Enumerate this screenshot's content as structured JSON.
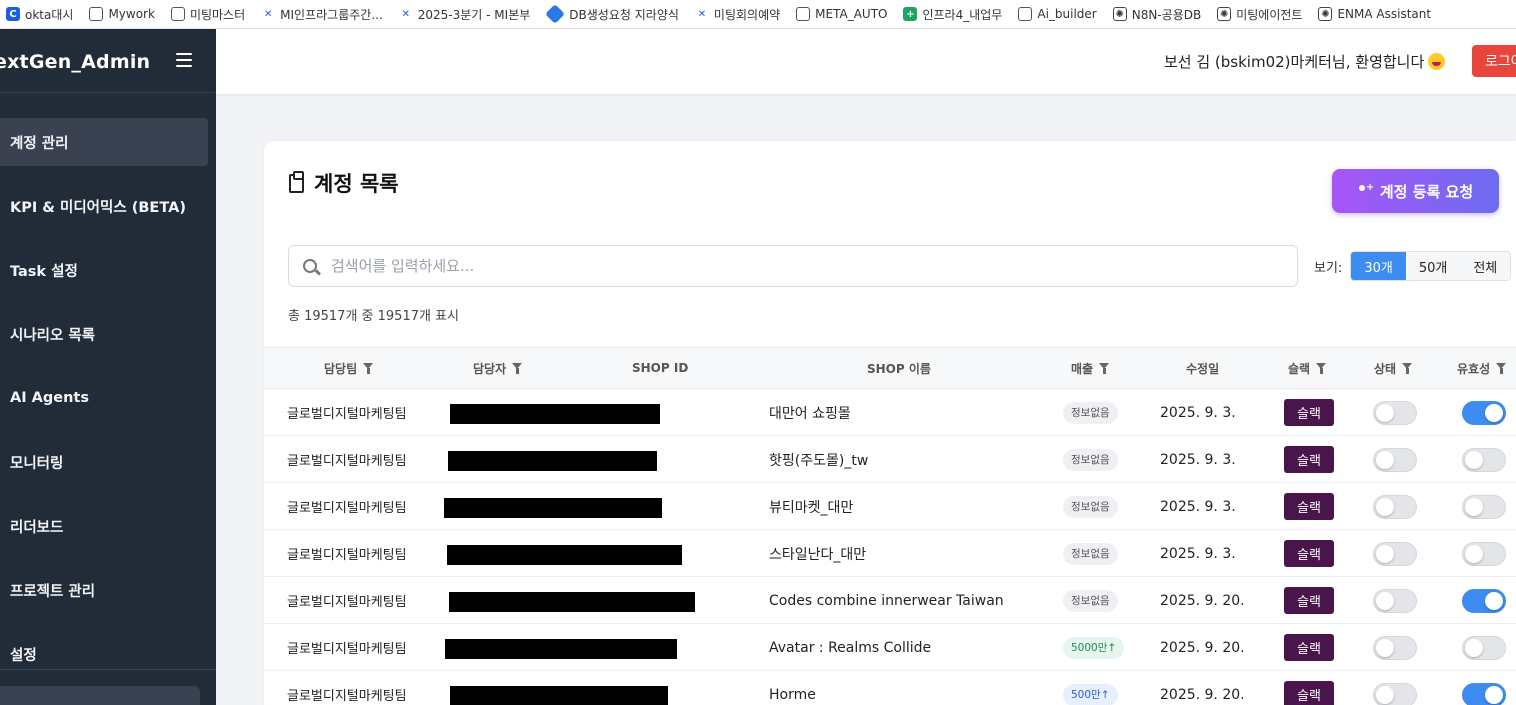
{
  "bookmarks": [
    {
      "label": "okta대시",
      "icon": "okta-icon"
    },
    {
      "label": "Mywork",
      "icon": "globe-icon"
    },
    {
      "label": "미팅마스터",
      "icon": "globe-icon"
    },
    {
      "label": "MI인프라그룹주간...",
      "icon": "confluence-icon"
    },
    {
      "label": "2025-3분기 - MI본부",
      "icon": "confluence-icon"
    },
    {
      "label": "DB생성요청 지라양식",
      "icon": "jira-icon"
    },
    {
      "label": "미팅회의예약",
      "icon": "confluence-icon"
    },
    {
      "label": "META_AUTO",
      "icon": "folder-icon"
    },
    {
      "label": "인프라4_내업무",
      "icon": "sheets-icon"
    },
    {
      "label": "Ai_builder",
      "icon": "folder-icon"
    },
    {
      "label": "N8N-공용DB",
      "icon": "openai-icon"
    },
    {
      "label": "미팅에이전트",
      "icon": "openai-icon"
    },
    {
      "label": "ENMA Assistant",
      "icon": "openai-icon"
    }
  ],
  "sidebar": {
    "brand": "extGen_Admin",
    "items": [
      {
        "label": "계정 관리",
        "active": true
      },
      {
        "label": "KPI & 미디어믹스 (BETA)",
        "active": false
      },
      {
        "label": "Task 설정",
        "active": false
      },
      {
        "label": "시나리오 목록",
        "active": false
      },
      {
        "label": "AI Agents",
        "active": false
      },
      {
        "label": "모니터링",
        "active": false
      },
      {
        "label": "리더보드",
        "active": false
      },
      {
        "label": "프로젝트 관리",
        "active": false
      },
      {
        "label": "설정",
        "active": false
      }
    ]
  },
  "header": {
    "welcome": "보선 김 (bskim02)마케터님, 환영합니다",
    "logout_label": "로그아웃"
  },
  "main": {
    "title": "계정 목록",
    "request_button": "계정 등록 요청",
    "search_placeholder": "검색어를 입력하세요...",
    "view_label": "보기:",
    "view_options": [
      {
        "label": "30개",
        "active": true
      },
      {
        "label": "50개",
        "active": false
      },
      {
        "label": "전체",
        "active": false
      }
    ],
    "count_text": "총 19517개 중 19517개 표시"
  },
  "table": {
    "columns": [
      "담당팀",
      "담당자",
      "SHOP ID",
      "SHOP 이름",
      "매출",
      "수정일",
      "슬랙",
      "상태",
      "유효성"
    ],
    "slack_label": "슬랙",
    "rows": [
      {
        "team": "글로벌디지털마케팅팀",
        "shop_name": "대만어 쇼핑몰",
        "sales": "정보없음",
        "sales_tone": "none",
        "date": "2025. 9. 3.",
        "status": false,
        "valid": true
      },
      {
        "team": "글로벌디지털마케팅팀",
        "shop_name": "핫핑(주도몰)_tw",
        "sales": "정보없음",
        "sales_tone": "none",
        "date": "2025. 9. 3.",
        "status": false,
        "valid": false
      },
      {
        "team": "글로벌디지털마케팅팀",
        "shop_name": "뷰티마켓_대만",
        "sales": "정보없음",
        "sales_tone": "none",
        "date": "2025. 9. 3.",
        "status": false,
        "valid": false
      },
      {
        "team": "글로벌디지털마케팅팀",
        "shop_name": "스타일난다_대만",
        "sales": "정보없음",
        "sales_tone": "none",
        "date": "2025. 9. 3.",
        "status": false,
        "valid": false
      },
      {
        "team": "글로벌디지털마케팅팀",
        "shop_name": "Codes combine innerwear Taiwan",
        "sales": "정보없음",
        "sales_tone": "none",
        "date": "2025. 9. 20.",
        "status": false,
        "valid": true
      },
      {
        "team": "글로벌디지털마케팅팀",
        "shop_name": "Avatar : Realms Collide",
        "sales": "5000만↑",
        "sales_tone": "green",
        "date": "2025. 9. 20.",
        "status": false,
        "valid": false
      },
      {
        "team": "글로벌디지털마케팅팀",
        "shop_name": "Horme",
        "sales": "500만↑",
        "sales_tone": "blue",
        "date": "2025. 9. 20.",
        "status": false,
        "valid": true
      }
    ]
  }
}
